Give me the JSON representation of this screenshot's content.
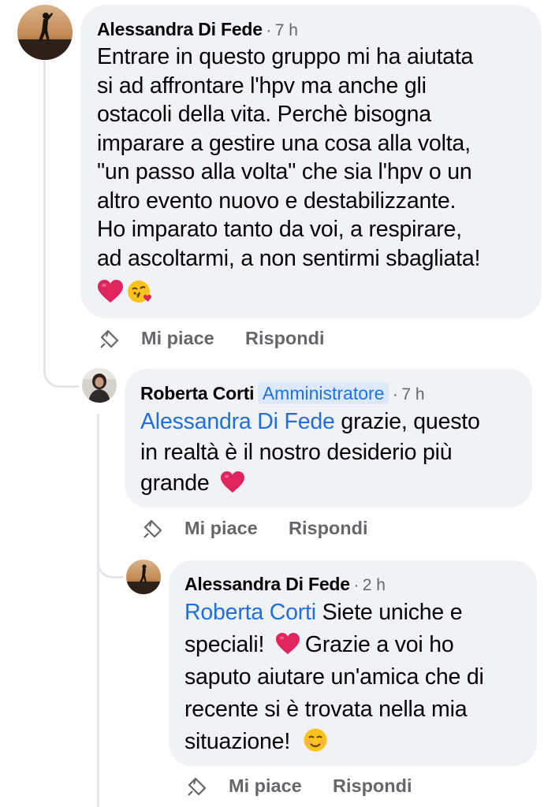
{
  "comment": {
    "author": "Alessandra Di Fede",
    "time": "7 h",
    "lines": [
      "Entrare in questo gruppo mi ha aiutata",
      "si ad affrontare l'hpv ma anche gli",
      "ostacoli della vita. Perchè bisogna",
      "imparare a gestire una cosa alla volta,",
      "\"un passo alla volta\" che sia l'hpv o un",
      "altro evento nuovo e destabilizzante.",
      "Ho imparato tanto da voi, a respirare,",
      "ad ascoltarmi, a non sentirmi sbagliata!"
    ],
    "emojis": [
      "red-heart",
      "face-blowing-kiss"
    ],
    "like_label": "Mi piace",
    "reply_label": "Rispondi"
  },
  "reply1": {
    "author": "Roberta Corti",
    "badge": "Amministratore",
    "time": "7 h",
    "mention": "Alessandra Di Fede",
    "line1_rest": " grazie, questo",
    "line2": "in realtà è il nostro desiderio più",
    "line3": "grande",
    "emojis": [
      "red-heart"
    ],
    "like_label": "Mi piace",
    "reply_label": "Rispondi"
  },
  "reply2": {
    "author": "Alessandra Di Fede",
    "time": "2 h",
    "mention": "Roberta Corti",
    "line1_rest": " Siete uniche e",
    "line2a": "speciali!",
    "line2b": "Grazie a voi ho",
    "line3": "saputo aiutare un'amica che di",
    "line4": "recente si è trovata nella mia",
    "line5": "situazione!",
    "emojis": [
      "red-heart",
      "smiling-face"
    ],
    "like_label": "Mi piace",
    "reply_label": "Rispondi"
  },
  "separator": "·",
  "colors": {
    "bubble": "#f0f2f5",
    "mention": "#216fdb",
    "meta": "#65676b",
    "admin_badge_bg": "#dde8f9",
    "admin_badge_text": "#1b74e4",
    "heart": "#e0245e"
  }
}
